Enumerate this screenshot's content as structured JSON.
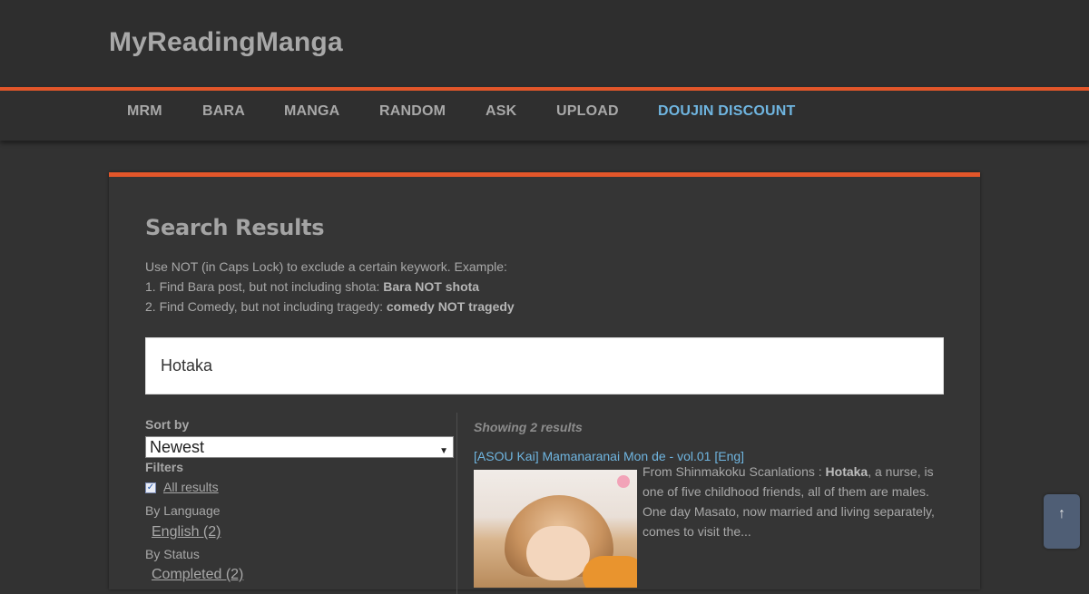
{
  "site": {
    "title": "MyReadingManga"
  },
  "nav": {
    "items": [
      {
        "label": "MRM"
      },
      {
        "label": "BARA"
      },
      {
        "label": "MANGA"
      },
      {
        "label": "RANDOM"
      },
      {
        "label": "ASK"
      },
      {
        "label": "UPLOAD"
      },
      {
        "label": "DOUJIN DISCOUNT",
        "accent": "#6fb5e0"
      }
    ]
  },
  "search": {
    "title": "Search Results",
    "help_line1": "Use NOT (in Caps Lock) to exclude a certain keywork. Example:",
    "help_line2_prefix": "1. Find Bara post, but not including shota: ",
    "help_line2_bold": "Bara NOT shota",
    "help_line3_prefix": "2. Find Comedy, but not including tragedy: ",
    "help_line3_bold": "comedy NOT tragedy",
    "query": "Hotaka"
  },
  "sidebar": {
    "sort_label": "Sort by",
    "sort_value": "Newest",
    "filters_label": "Filters",
    "all_results": "All results",
    "all_results_checked": true,
    "language_label": "By Language",
    "language_option": "English (2)",
    "status_label": "By Status",
    "status_option": "Completed (2)"
  },
  "results": {
    "count_text": "Showing 2 results",
    "items": [
      {
        "title": "[ASOU Kai] Mamanaranai Mon de - vol.01 [Eng]",
        "excerpt_prefix": "From Shinmakoku Scanlations : ",
        "excerpt_bold": "Hotaka",
        "excerpt_suffix": ", a nurse, is one of five childhood friends, all of them are males. One day Masato, now married and living separately, comes to visit the..."
      }
    ]
  },
  "scroll_top": {
    "icon": "arrow-up-icon",
    "glyph": "↑"
  },
  "colors": {
    "accent_orange": "#e2562a",
    "link_blue": "#6fb5e0",
    "background": "#323232"
  }
}
